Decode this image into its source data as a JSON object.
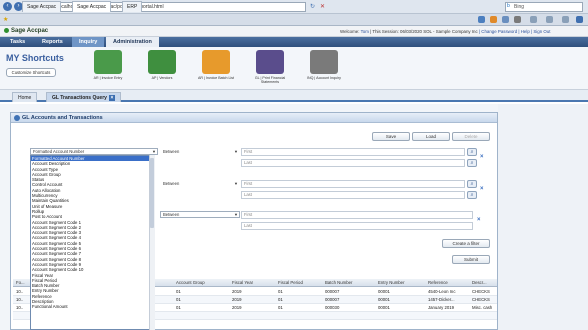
{
  "browser": {
    "address": "http://localhost/sageERPAccpac/portal/site/portal.html",
    "search_placeholder": "Bing",
    "tabs": [
      {
        "label": "Sage Accpac"
      },
      {
        "label": "Sage Accpac"
      },
      {
        "label": "ERP"
      }
    ]
  },
  "header": {
    "logo": "Sage Accpac",
    "welcome_prefix": "Welcome:",
    "user": "Tom",
    "session_prefix": "| This Session:",
    "session": "06/03/2020 SOL - Sample Company Inc",
    "links": "| Change Password | Help | Sign Out"
  },
  "main_nav": {
    "items": [
      {
        "label": "Tasks"
      },
      {
        "label": "Reports"
      },
      {
        "label": "Inquiry"
      },
      {
        "label": "Administration"
      }
    ]
  },
  "shortcuts": {
    "title": "MY Shortcuts",
    "customize_label": "Customize Shortcuts",
    "items": [
      {
        "label": "AR | Invoice Entry",
        "color": "#4a9a4a"
      },
      {
        "label": "AP | Vendors",
        "color": "#3f8f3f"
      },
      {
        "label": "AR | Invoice Batch List",
        "color": "#e79a2c"
      },
      {
        "label": "GL | Print Financial Statements",
        "color": "#5a4d8c"
      },
      {
        "label": "INQ | Account Inquiry",
        "color": "#7a7a7a"
      }
    ]
  },
  "page_tabs": [
    {
      "label": "Home"
    },
    {
      "label": "GL Transactions Query"
    }
  ],
  "panel": {
    "title": "GL Accounts and Transactions",
    "buttons": {
      "save": "Save",
      "load": "Load",
      "delete": "Delete"
    },
    "filters": [
      {
        "field": "Formatted Account Number",
        "op": "Between",
        "first": "First",
        "last": "Last"
      },
      {
        "field": "",
        "op": "Between",
        "first": "First",
        "last": "Last"
      },
      {
        "field": "",
        "op": "Between",
        "first": "First",
        "last": "Last"
      }
    ],
    "create_filter_label": "Create a filter",
    "submit_label": "Submit"
  },
  "dropdown_options": [
    "Formatted Account Number",
    "Account Description",
    "Account Type",
    "Account Group",
    "Status",
    "Control Account",
    "Auto Allocation",
    "Multicurrency",
    "Maintain Quantities",
    "Unit of Measure",
    "Rollup",
    "Post to Account",
    "Account Segment Code 1",
    "Account Segment Code 2",
    "Account Segment Code 3",
    "Account Segment Code 4",
    "Account Segment Code 5",
    "Account Segment Code 6",
    "Account Segment Code 7",
    "Account Segment Code 8",
    "Account Segment Code 9",
    "Account Segment Code 10",
    "Fiscal Year",
    "Fiscal Period",
    "Batch Number",
    "Entry Number",
    "Reference",
    "Description",
    "Functional Amount"
  ],
  "table": {
    "columns": [
      "Fo...",
      "Account Group",
      "Fiscal Year",
      "Fiscal Period",
      "Batch Number",
      "Entry Number",
      "Reference",
      "Descr..."
    ],
    "rows": [
      {
        "c0": "10..",
        "c1": "01",
        "c2": "2019",
        "c3": "01",
        "c4": "000007",
        "c5": "00001",
        "c6": "4540-Leon Inc",
        "c7": "CHECKS"
      },
      {
        "c0": "10..",
        "c1": "01",
        "c2": "2019",
        "c3": "01",
        "c4": "000007",
        "c5": "00001",
        "c6": "1457-Dicker...",
        "c7": "CHECKS"
      },
      {
        "c0": "10..",
        "c1": "01",
        "c2": "2019",
        "c3": "01",
        "c4": "000030",
        "c5": "00001",
        "c6": "January 2019",
        "c7": "Misc. cash"
      }
    ]
  }
}
